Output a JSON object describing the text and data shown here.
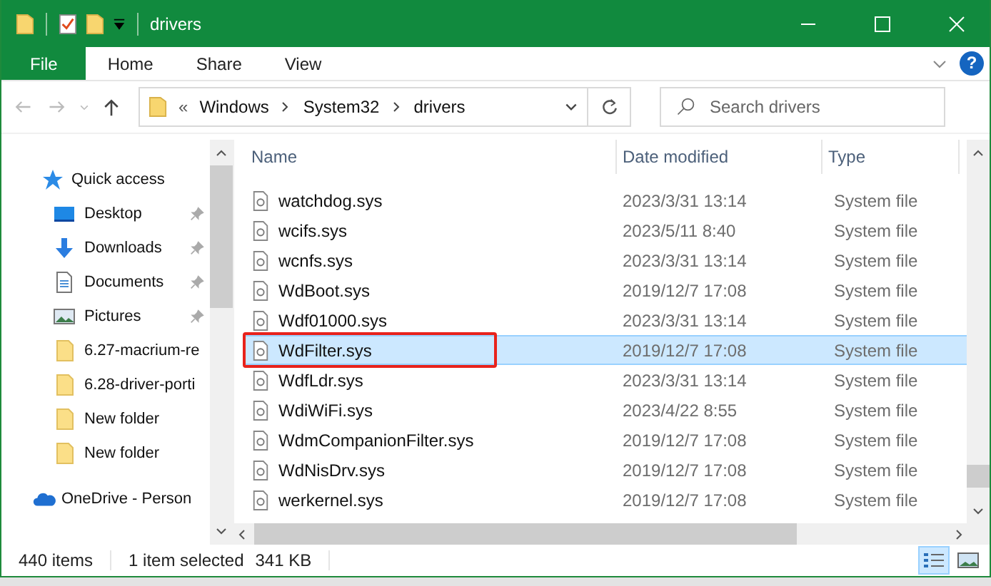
{
  "window": {
    "title": "drivers"
  },
  "ribbon_tabs": [
    {
      "label": "File",
      "kind": "file",
      "selected": false
    },
    {
      "label": "Home",
      "kind": "tab",
      "selected": false
    },
    {
      "label": "Share",
      "kind": "tab",
      "selected": false
    },
    {
      "label": "View",
      "kind": "tab",
      "selected": false
    }
  ],
  "help": {
    "label": "?"
  },
  "address": {
    "overflow": "«",
    "segments": [
      "Windows",
      "System32",
      "drivers"
    ]
  },
  "search": {
    "placeholder": "Search drivers"
  },
  "sidebar": {
    "items": [
      {
        "label": "Quick access",
        "kind": "star",
        "pinned": false
      },
      {
        "label": "Desktop",
        "kind": "desktop",
        "pinned": true
      },
      {
        "label": "Downloads",
        "kind": "downloads",
        "pinned": true
      },
      {
        "label": "Documents",
        "kind": "documents",
        "pinned": true
      },
      {
        "label": "Pictures",
        "kind": "pictures",
        "pinned": true
      },
      {
        "label": "6.27-macrium-re",
        "kind": "folder",
        "pinned": false
      },
      {
        "label": "6.28-driver-porti",
        "kind": "folder",
        "pinned": false
      },
      {
        "label": "New folder",
        "kind": "folder",
        "pinned": false
      },
      {
        "label": "New folder",
        "kind": "folder",
        "pinned": false
      },
      {
        "label": "OneDrive - Person",
        "kind": "cloud",
        "pinned": false
      }
    ]
  },
  "table": {
    "columns": [
      "Name",
      "Date modified",
      "Type"
    ],
    "rows": [
      {
        "name": "watchdog.sys",
        "date": "2023/3/31 13:14",
        "type": "System file",
        "selected": false,
        "outlined": false
      },
      {
        "name": "wcifs.sys",
        "date": "2023/5/11 8:40",
        "type": "System file",
        "selected": false,
        "outlined": false
      },
      {
        "name": "wcnfs.sys",
        "date": "2023/3/31 13:14",
        "type": "System file",
        "selected": false,
        "outlined": false
      },
      {
        "name": "WdBoot.sys",
        "date": "2019/12/7 17:08",
        "type": "System file",
        "selected": false,
        "outlined": false
      },
      {
        "name": "Wdf01000.sys",
        "date": "2023/3/31 13:14",
        "type": "System file",
        "selected": false,
        "outlined": false
      },
      {
        "name": "WdFilter.sys",
        "date": "2019/12/7 17:08",
        "type": "System file",
        "selected": true,
        "outlined": true
      },
      {
        "name": "WdfLdr.sys",
        "date": "2023/3/31 13:14",
        "type": "System file",
        "selected": false,
        "outlined": false
      },
      {
        "name": "WdiWiFi.sys",
        "date": "2023/4/22 8:55",
        "type": "System file",
        "selected": false,
        "outlined": false
      },
      {
        "name": "WdmCompanionFilter.sys",
        "date": "2019/12/7 17:08",
        "type": "System file",
        "selected": false,
        "outlined": false
      },
      {
        "name": "WdNisDrv.sys",
        "date": "2019/12/7 17:08",
        "type": "System file",
        "selected": false,
        "outlined": false
      },
      {
        "name": "werkernel.sys",
        "date": "2019/12/7 17:08",
        "type": "System file",
        "selected": false,
        "outlined": false
      }
    ]
  },
  "status_bar": {
    "count": "440 items",
    "selection": "1 item selected",
    "size": "341 KB",
    "views": [
      {
        "kind": "details",
        "selected": true
      },
      {
        "kind": "thumbnails",
        "selected": false
      }
    ]
  }
}
